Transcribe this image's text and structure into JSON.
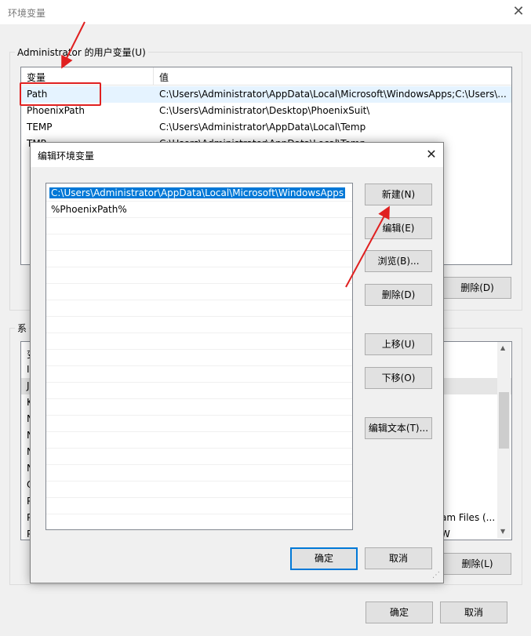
{
  "window": {
    "title": "环境变量"
  },
  "user_vars": {
    "group_label": "Administrator 的用户变量(U)",
    "col_var": "变量",
    "col_val": "值",
    "rows": [
      {
        "name": "Path",
        "value": "C:\\Users\\Administrator\\AppData\\Local\\Microsoft\\WindowsApps;C:\\Users\\..."
      },
      {
        "name": "PhoenixPath",
        "value": "C:\\Users\\Administrator\\Desktop\\PhoenixSuit\\"
      },
      {
        "name": "TEMP",
        "value": "C:\\Users\\Administrator\\AppData\\Local\\Temp"
      },
      {
        "name": "TMP",
        "value": "C:\\Users\\Administrator\\AppData\\Local\\Temp"
      }
    ],
    "delete_label": "删除(D)"
  },
  "system_vars": {
    "group_label": "系",
    "col_var": "变",
    "row_initials": [
      "I",
      "J",
      "K",
      "N",
      "N",
      "N",
      "N",
      "O",
      "P",
      "P",
      "P"
    ],
    "value_fragment_1": "am Files (...",
    "value_fragment_2": "W",
    "delete_label": "删除(L)"
  },
  "footer": {
    "ok_label": "确定",
    "cancel_label": "取消"
  },
  "edit_dialog": {
    "title": "编辑环境变量",
    "entries": [
      "C:\\Users\\Administrator\\AppData\\Local\\Microsoft\\WindowsApps",
      "%PhoenixPath%"
    ],
    "buttons": {
      "new": "新建(N)",
      "edit": "编辑(E)",
      "browse": "浏览(B)...",
      "delete": "删除(D)",
      "move_up": "上移(U)",
      "move_down": "下移(O)",
      "edit_text": "编辑文本(T)..."
    },
    "ok_label": "确定",
    "cancel_label": "取消"
  },
  "colors": {
    "accent": "#0078d7",
    "annotation": "#e02020"
  }
}
